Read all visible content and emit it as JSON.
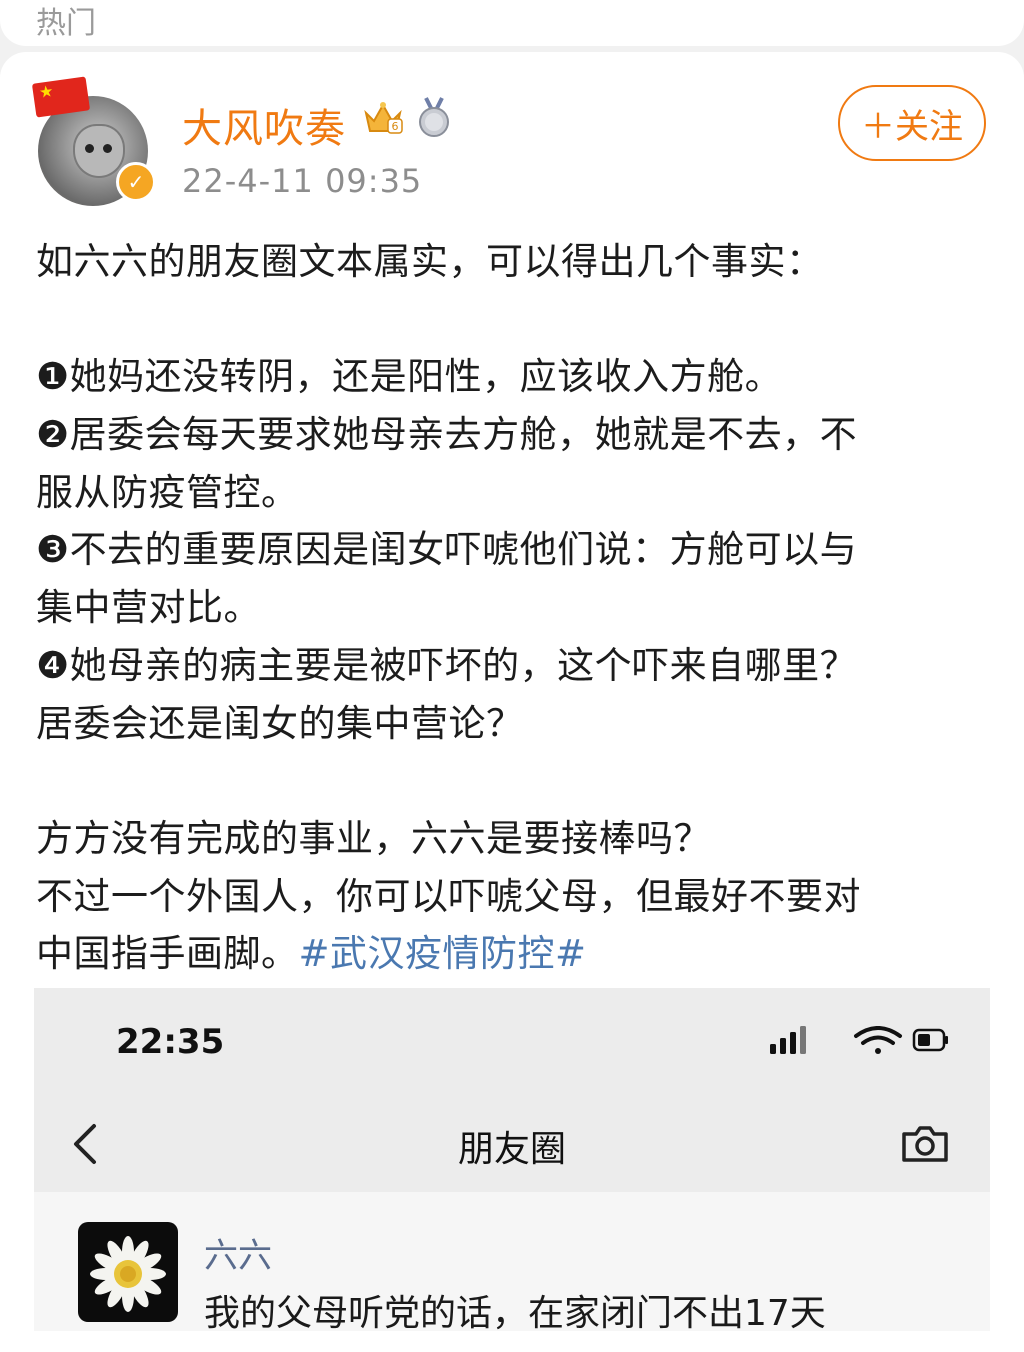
{
  "header": {
    "tab_label": "热门"
  },
  "post": {
    "author": {
      "name": "大风吹奏",
      "timestamp": "22-4-11 09:35",
      "avatar_icon": "cat-avatar-with-flag",
      "badges": [
        "vip-crown-badge-6",
        "medal-badge"
      ]
    },
    "follow_label": "＋关注",
    "body_lines": [
      "如六六的朋友圈文本属实，可以得出几个事实：",
      "",
      "❶她妈还没转阴，还是阳性，应该收入方舱。",
      "❷居委会每天要求她母亲去方舱，她就是不去，不",
      "服从防疫管控。",
      "❸不去的重要原因是闺女吓唬他们说：方舱可以与",
      "集中营对比。",
      "❹她母亲的病主要是被吓坏的，这个吓来自哪里？",
      "居委会还是闺女的集中营论？",
      "",
      "方方没有完成的事业，六六是要接棒吗？",
      "不过一个外国人，你可以吓唬父母，但最好不要对"
    ],
    "last_line_text": "中国指手画脚。",
    "hashtag": "#武汉疫情防控#"
  },
  "embedded_screenshot": {
    "status_time": "22:35",
    "nav_title": "朋友圈",
    "friend_name": "六六",
    "friend_text": "我的父母听党的话，在家闭门不出17天"
  },
  "colors": {
    "accent_orange": "#f07a12",
    "hashtag_blue": "#4a78b0",
    "friend_name_blue": "#5a6c8e"
  }
}
